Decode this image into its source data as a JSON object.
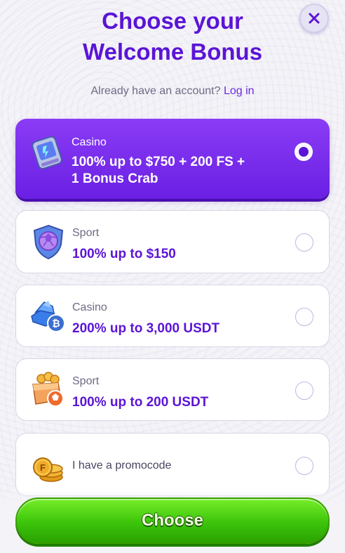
{
  "header": {
    "title_line1": "Choose your",
    "title_line2": "Welcome Bonus",
    "close_icon": "close-x-icon"
  },
  "login": {
    "prompt": "Already have an account?",
    "link": "Log in"
  },
  "bonuses": [
    {
      "category": "Casino",
      "offer_line1": "100% up to $750 + 200 FS +",
      "offer_line2": "1 Bonus Crab",
      "icon": "slot-machine-icon",
      "selected": true
    },
    {
      "category": "Sport",
      "offer_line1": "100% up to $150",
      "icon": "shield-ball-icon",
      "selected": false
    },
    {
      "category": "Casino",
      "offer_line1": "200% up to 3,000 USDT",
      "icon": "crypto-coin-icon",
      "selected": false
    },
    {
      "category": "Sport",
      "offer_line1": "100% up to 200 USDT",
      "icon": "treasure-chest-icon",
      "selected": false
    }
  ],
  "promo": {
    "label": "I have a promocode",
    "icon": "coin-stack-icon"
  },
  "action": {
    "choose_label": "Choose"
  },
  "colors": {
    "accent": "#5b14d6",
    "selected_card": "#7b2ff0",
    "cta": "#3cc40a"
  }
}
